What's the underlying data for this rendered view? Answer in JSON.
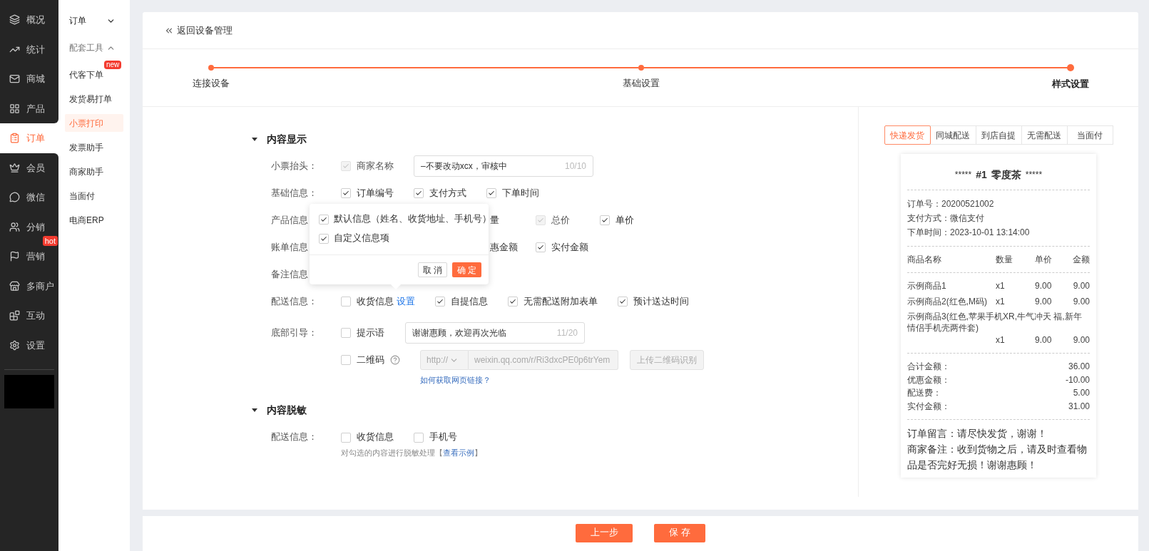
{
  "sidebar": {
    "items": [
      {
        "label": "概况",
        "selected": false
      },
      {
        "label": "统计",
        "selected": false
      },
      {
        "label": "商城",
        "selected": false
      },
      {
        "label": "产品",
        "selected": false
      },
      {
        "label": "订单",
        "selected": true
      },
      {
        "label": "会员",
        "selected": false
      },
      {
        "label": "微信",
        "selected": false
      },
      {
        "label": "分销",
        "selected": false
      },
      {
        "label": "营销",
        "selected": false,
        "badge": "hot"
      },
      {
        "label": "多商户",
        "selected": false
      },
      {
        "label": "互动",
        "selected": false
      },
      {
        "label": "设置",
        "selected": false
      }
    ]
  },
  "submenu": {
    "items": [
      {
        "kind": "group",
        "label": "订单",
        "expanded": false
      },
      {
        "kind": "group",
        "label": "配套工具",
        "expanded": true
      },
      {
        "kind": "link",
        "label": "代客下单",
        "selected": false,
        "badge": "new"
      },
      {
        "kind": "link",
        "label": "发货易打单",
        "selected": false
      },
      {
        "kind": "link",
        "label": "小票打印",
        "selected": true
      },
      {
        "kind": "link",
        "label": "发票助手",
        "selected": false
      },
      {
        "kind": "link",
        "label": "商家助手",
        "selected": false
      },
      {
        "kind": "link",
        "label": "当面付",
        "selected": false
      },
      {
        "kind": "link",
        "label": "电商ERP",
        "selected": false
      }
    ]
  },
  "header": {
    "back_link": "返回设备管理"
  },
  "steps": [
    {
      "label": "连接设备",
      "selected": false
    },
    {
      "label": "基础设置",
      "selected": false
    },
    {
      "label": "样式设置",
      "selected": true
    }
  ],
  "sections": [
    {
      "title": "内容显示",
      "expanded": true,
      "rows": [
        {
          "label": "小票抬头：",
          "items": [
            {
              "kind": "check",
              "label": "商家名称",
              "checked": true,
              "disabled": true
            },
            {
              "kind": "input",
              "value": "–不要改动xcx，审核中",
              "counter": "10/10"
            }
          ]
        },
        {
          "label": "基础信息：",
          "items": [
            {
              "kind": "check",
              "label": "订单编号",
              "checked": true,
              "disabled": false
            },
            {
              "kind": "check",
              "label": "支付方式",
              "checked": true,
              "disabled": false
            },
            {
              "kind": "check",
              "label": "下单时间",
              "checked": true,
              "disabled": false
            }
          ]
        },
        {
          "label": "产品信息",
          "items": [
            {
              "kind": "fragment",
              "label": "量"
            },
            {
              "kind": "check",
              "label": "总价",
              "checked": true,
              "disabled": true
            },
            {
              "kind": "check",
              "label": "单价",
              "checked": true,
              "disabled": false
            }
          ]
        },
        {
          "label": "账单信息",
          "items": [
            {
              "kind": "fragment",
              "label": "惠金额"
            },
            {
              "kind": "check",
              "label": "实付金额",
              "checked": true,
              "disabled": false
            }
          ]
        },
        {
          "label": "备注信息"
        },
        {
          "label": "配送信息：",
          "items": [
            {
              "kind": "check",
              "label": "收货信息",
              "checked": false,
              "disabled": false,
              "link": "设置"
            },
            {
              "kind": "check",
              "label": "自提信息",
              "checked": true,
              "disabled": false
            },
            {
              "kind": "check",
              "label": "无需配送附加表单",
              "checked": true,
              "disabled": false
            },
            {
              "kind": "check",
              "label": "预计送达时间",
              "checked": true,
              "disabled": false
            }
          ]
        },
        {
          "label": "底部引导：",
          "items": [
            {
              "kind": "check",
              "label": "提示语",
              "checked": false,
              "disabled": false
            },
            {
              "kind": "input",
              "value": "谢谢惠顾，欢迎再次光临",
              "counter": "11/20"
            }
          ]
        },
        {
          "items": [
            {
              "kind": "check",
              "label": "二维码",
              "checked": false,
              "disabled": false,
              "help": true
            },
            {
              "kind": "url",
              "scheme": "http://",
              "value": "weixin.qq.com/r/Ri3dxcPE0p6trYem",
              "disabled": true,
              "button": "上传二维码识别",
              "link": "如何获取网页链接？"
            }
          ]
        }
      ]
    },
    {
      "title": "内容脱敏",
      "expanded": true,
      "rows": [
        {
          "label": "配送信息：",
          "items": [
            {
              "kind": "check",
              "label": "收货信息",
              "checked": false,
              "disabled": false
            },
            {
              "kind": "check",
              "label": "手机号",
              "checked": false,
              "disabled": false
            }
          ],
          "note": {
            "text": "对勾选的内容进行脱敏处理【",
            "link": "查看示例",
            "after": "】"
          }
        }
      ]
    }
  ],
  "popover": {
    "options": [
      {
        "label": "默认信息（姓名、收货地址、手机号）",
        "checked": true
      },
      {
        "label": "自定义信息项",
        "checked": true
      }
    ],
    "buttons": [
      {
        "label": "取 消",
        "kind": "default"
      },
      {
        "label": "确 定",
        "kind": "primary"
      }
    ]
  },
  "preview": {
    "tabs": [
      {
        "label": "快递发货",
        "selected": true
      },
      {
        "label": "同城配送",
        "selected": false
      },
      {
        "label": "到店自提",
        "selected": false
      },
      {
        "label": "无需配送",
        "selected": false
      },
      {
        "label": "当面付",
        "selected": false
      }
    ],
    "receipt": {
      "decoration": "*****",
      "order_no": "#1",
      "shop": "零度茶",
      "decoration_end": "*****",
      "info": [
        "订单号：20200521002",
        "支付方式：微信支付",
        "下单时间：2023-10-01 13:14:00"
      ],
      "columns": [
        "商品名称",
        "数量",
        "单价",
        "金额"
      ],
      "items": [
        {
          "kind": "inline",
          "name": "示例商品1",
          "qty": "x1",
          "price": "9.00",
          "amount": "9.00"
        },
        {
          "kind": "inline",
          "name": "示例商品2(红色,M码)",
          "qty": "x1",
          "price": "9.00",
          "amount": "9.00"
        },
        {
          "kind": "wrapped",
          "name": "示例商品3(红色,苹果手机XR,牛气冲天 福,新年情侣手机壳两件套)",
          "qty": "x1",
          "price": "9.00",
          "amount": "9.00"
        }
      ],
      "totals": [
        {
          "label": "合计金额：",
          "value": "36.00"
        },
        {
          "label": "优惠金额：",
          "value": "-10.00"
        },
        {
          "label": "配送费：",
          "value": "5.00"
        },
        {
          "label": "实付金额：",
          "value": "31.00"
        }
      ],
      "notes": [
        "订单留言：请尽快发货，谢谢！",
        "商家备注：收到货物之后，请及时查看物品是否完好无损！谢谢惠顾！"
      ]
    }
  },
  "footer": {
    "buttons": [
      {
        "label": "上一步",
        "kind": "primary"
      },
      {
        "label": "保 存",
        "kind": "primary"
      }
    ]
  }
}
